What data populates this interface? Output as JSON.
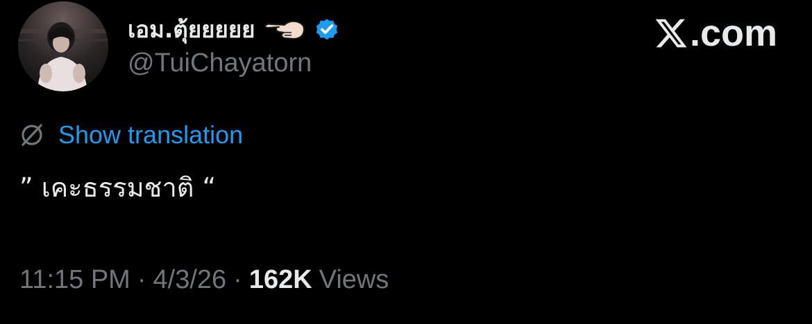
{
  "author": {
    "display_name": "เอม.ตุ้ยยยยย",
    "handle": "@TuiChayatorn",
    "verified": true,
    "name_emoji": "backhand-index-pointing-left",
    "badge_color": "#1d9bf0"
  },
  "brand": {
    "text": ".com",
    "icon": "x-logo"
  },
  "translate": {
    "label": "Show translation",
    "icon": "globe-slash-icon",
    "color": "#1d9bf0"
  },
  "tweet": {
    "text": "” เคะธรรมชาติ “"
  },
  "meta": {
    "time": "11:15 PM",
    "separator": "·",
    "date": "4/3/26",
    "views_count": "162K",
    "views_label": "Views"
  },
  "colors": {
    "background": "#000000",
    "primary_text": "#e7e9ea",
    "secondary_text": "#71767b",
    "link": "#1d9bf0"
  }
}
